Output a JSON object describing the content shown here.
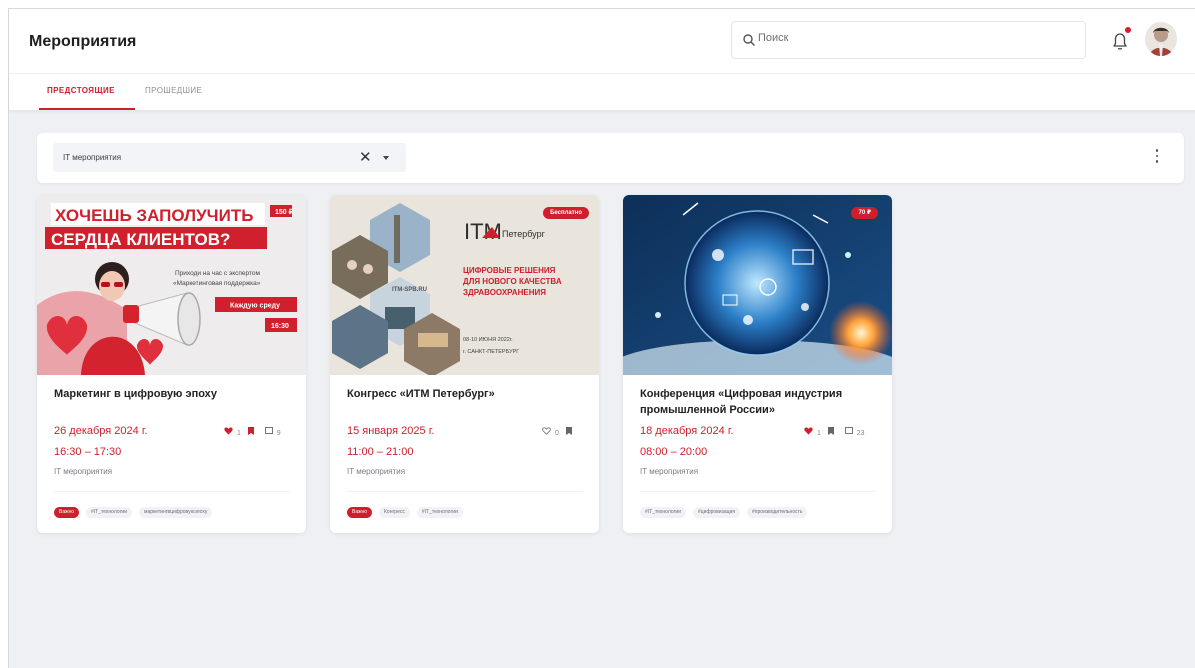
{
  "header": {
    "title": "Мероприятия",
    "search_placeholder": "Поиск"
  },
  "tabs": [
    {
      "label": "ПРЕДСТОЯЩИЕ",
      "active": true
    },
    {
      "label": "ПРОШЕДШИЕ",
      "active": false
    }
  ],
  "filter": {
    "selected": "IT мероприятия",
    "clear_icon": "close-icon",
    "caret_icon": "chevron-down-icon",
    "menu_icon": "kebab-menu-icon"
  },
  "colors": {
    "accent": "#cf1e2c",
    "background": "#eef0f4"
  },
  "events": [
    {
      "title": "Маркетинг в цифровую эпоху",
      "date": "26 декабря 2024 г.",
      "time": "16:30 – 17:30",
      "category": "IT мероприятия",
      "likes": "1",
      "comments": "9",
      "liked": true,
      "bookmarked": true,
      "price": "150 ₽",
      "tags": [
        {
          "label": "Важно",
          "accent": true
        },
        {
          "label": "#IT_технологии",
          "accent": false
        },
        {
          "label": "маркетингвцифровуюэпоху",
          "accent": false
        }
      ],
      "image": {
        "headline_1": "ХОЧЕШЬ ЗАПОЛУЧИТЬ",
        "headline_2": "СЕРДЦА КЛИЕНТОВ?",
        "subtitle_1": "Приходи на час с экспертом",
        "subtitle_2": "«Маркетинговая поддержка»",
        "badge_1": "Каждую среду",
        "badge_2": "16:30"
      }
    },
    {
      "title": "Конгресс «ИТМ Петербург»",
      "date": "15 января 2025 г.",
      "time": "11:00 – 21:00",
      "category": "IT мероприятия",
      "likes": "0",
      "comments": "",
      "liked": false,
      "bookmarked": true,
      "price": "Бесплатно",
      "tags": [
        {
          "label": "Важно",
          "accent": true
        },
        {
          "label": "Конгресс",
          "accent": false
        },
        {
          "label": "#IT_технологии",
          "accent": false
        }
      ],
      "image": {
        "brand": "ITM",
        "brand_city": "Петербург",
        "site": "ITM-SPB.RU",
        "headline_1": "ЦИФРОВЫЕ РЕШЕНИЯ",
        "headline_2": "ДЛЯ НОВОГО КАЧЕСТВА",
        "headline_3": "ЗДРАВООХРАНЕНИЯ",
        "dates": "08-10 ИЮНЯ 2022г.",
        "city": "г. САНКТ-ПЕТЕРБУРГ"
      }
    },
    {
      "title": "Конференция «Цифровая индустрия промышленной России»",
      "date": "18 декабря 2024 г.",
      "time": "08:00 – 20:00",
      "category": "IT мероприятия",
      "likes": "1",
      "comments": "23",
      "liked": true,
      "bookmarked": true,
      "price": "70 ₽",
      "tags": [
        {
          "label": "#IT_технологии",
          "accent": false
        },
        {
          "label": "#цифровизация",
          "accent": false
        },
        {
          "label": "#производительность",
          "accent": false
        }
      ]
    }
  ]
}
